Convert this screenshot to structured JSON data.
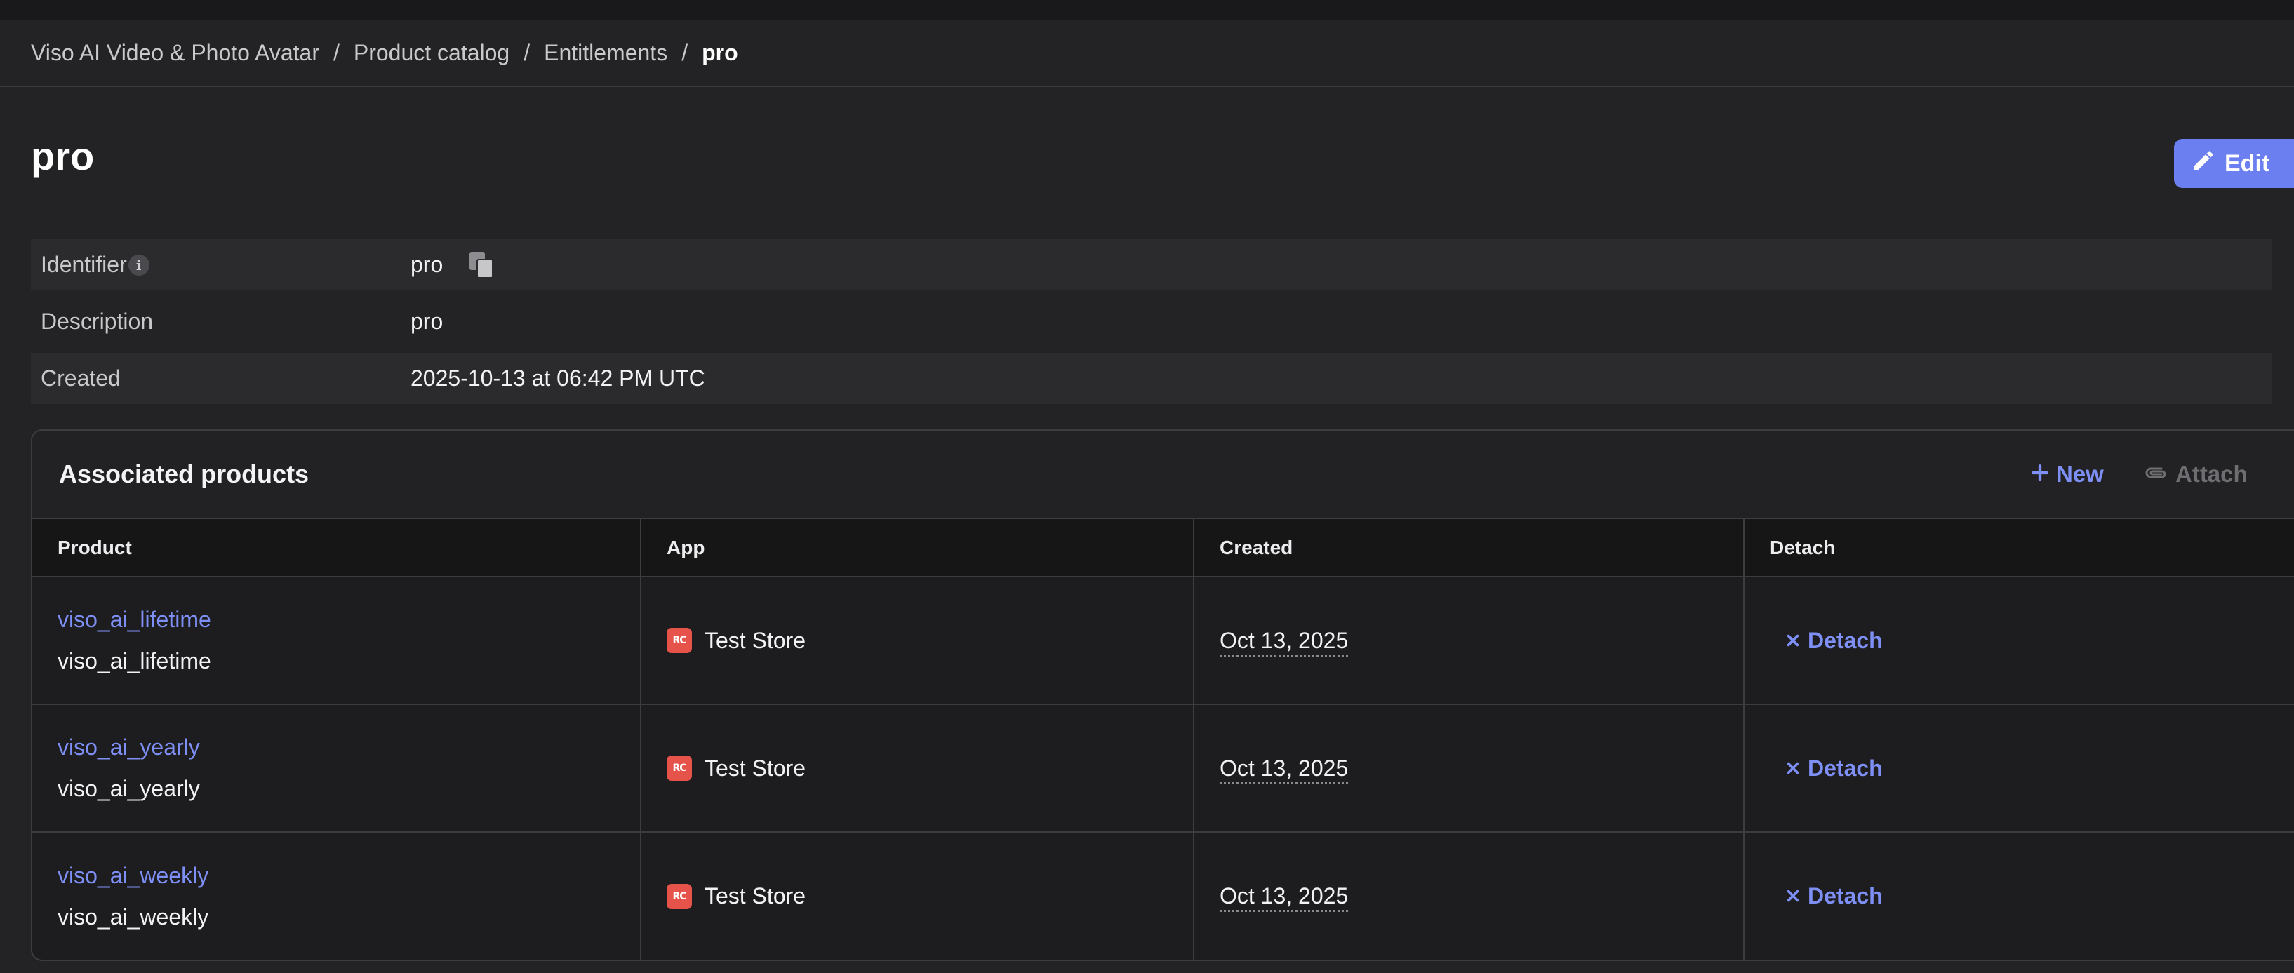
{
  "breadcrumb": {
    "items": [
      "Viso AI Video & Photo Avatar",
      "Product catalog",
      "Entitlements"
    ],
    "separator": "/",
    "current": "pro"
  },
  "page": {
    "title": "pro",
    "edit_label": "Edit"
  },
  "details": {
    "identifier_label": "Identifier",
    "identifier_value": "pro",
    "description_label": "Description",
    "description_value": "pro",
    "created_label": "Created",
    "created_value": "2025-10-13 at 06:42 PM UTC"
  },
  "associated": {
    "title": "Associated products",
    "new_label": "New",
    "attach_label": "Attach",
    "columns": [
      "Product",
      "App",
      "Created",
      "Detach"
    ],
    "rows": [
      {
        "product_link": "viso_ai_lifetime",
        "product_sub": "viso_ai_lifetime",
        "app": "Test Store",
        "created": "Oct 13, 2025",
        "detach": "Detach"
      },
      {
        "product_link": "viso_ai_yearly",
        "product_sub": "viso_ai_yearly",
        "app": "Test Store",
        "created": "Oct 13, 2025",
        "detach": "Detach"
      },
      {
        "product_link": "viso_ai_weekly",
        "product_sub": "viso_ai_weekly",
        "app": "Test Store",
        "created": "Oct 13, 2025",
        "detach": "Detach"
      }
    ],
    "app_icon_text": "RC"
  },
  "colors": {
    "background": "#232325",
    "accent": "#7e8ff5",
    "edit_button": "#6b7ff0",
    "store_icon": "#e5534b"
  },
  "icons": [
    "info-icon",
    "copy-icon",
    "pencil-icon",
    "plus-icon",
    "paperclip-icon",
    "close-icon",
    "store-icon"
  ]
}
